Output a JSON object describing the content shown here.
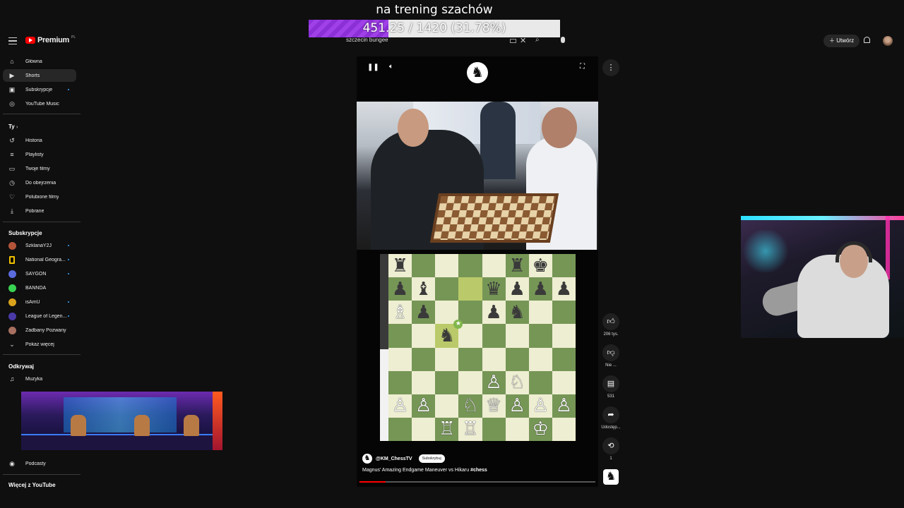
{
  "overlay": {
    "goal_title": "na trening szachów",
    "goal_text": "451.25 / 1420 (31.78%)",
    "goal_fraction": 0.3178,
    "bar_color": "#9a3ae0"
  },
  "topbar": {
    "brand": "Premium",
    "country": "PL",
    "search_value": "szczecin bungee",
    "create_label": "Utwórz"
  },
  "sidebar": {
    "main_items": [
      {
        "label": "Główna",
        "icon": "home-icon"
      },
      {
        "label": "Shorts",
        "icon": "shorts-icon",
        "active": true
      },
      {
        "label": "Subskrypcje",
        "icon": "subscriptions-icon"
      },
      {
        "label": "YouTube Music",
        "icon": "music-icon"
      }
    ],
    "you_heading": "Ty",
    "you_items": [
      {
        "label": "Historia",
        "icon": "history-icon"
      },
      {
        "label": "Playlisty",
        "icon": "playlist-icon"
      },
      {
        "label": "Twoje filmy",
        "icon": "your-videos-icon"
      },
      {
        "label": "Do obejrzenia",
        "icon": "watch-later-icon"
      },
      {
        "label": "Polubione filmy",
        "icon": "liked-icon"
      },
      {
        "label": "Pobrane",
        "icon": "download-icon"
      }
    ],
    "subs_heading": "Subskrypcje",
    "subs": [
      {
        "label": "SzklanaY2J",
        "color": "#b4553a"
      },
      {
        "label": "National Geogra...",
        "color": "#f2c200"
      },
      {
        "label": "SAYGON",
        "color": "#5a6bdc"
      },
      {
        "label": "BANNDA",
        "color": "#39d353"
      },
      {
        "label": "isAmU",
        "color": "#d9a21c"
      },
      {
        "label": "League of Legen...",
        "color": "#4a3aa8"
      },
      {
        "label": "Zadbany Pozwany",
        "color": "#a87060"
      }
    ],
    "show_more": "Pokaż więcej",
    "explore_heading": "Odkrywaj",
    "explore_items": [
      {
        "label": "Muzyka",
        "icon": "music-note-icon"
      },
      {
        "label": "Podcasty",
        "icon": "podcast-icon"
      }
    ],
    "more_heading": "Więcej z YouTube"
  },
  "player": {
    "channel_name": "@KM_ChessTV",
    "subscribe_label": "Subskrybuj",
    "title_text": "Magnus' Amazing Endgame Maneuver vs Hikaru ",
    "title_hashtag": "#chess",
    "progress_fraction": 0.11
  },
  "board": {
    "rows": [
      [
        "♜",
        "",
        "",
        "",
        "",
        "♜",
        "♚",
        ""
      ],
      [
        "♟",
        "♝",
        "",
        "",
        "♛",
        "♟",
        "♟",
        "♟"
      ],
      [
        "♗",
        "♟",
        "",
        "",
        "♟",
        "♞",
        "",
        ""
      ],
      [
        "",
        "",
        "♞",
        "",
        "",
        "",
        "",
        ""
      ],
      [
        "",
        "",
        "",
        "",
        "",
        "",
        "",
        ""
      ],
      [
        "",
        "",
        "",
        "",
        "♙",
        "♘",
        "",
        ""
      ],
      [
        "♙",
        "♙",
        "",
        "♘",
        "♕",
        "♙",
        "♙",
        "♙"
      ],
      [
        "",
        "",
        "♖",
        "♖",
        "",
        "",
        "♔",
        ""
      ]
    ],
    "white_pieces": [
      "♔",
      "♕",
      "♖",
      "♗",
      "♘",
      "♙"
    ],
    "highlight": [
      [
        1,
        3
      ],
      [
        3,
        2
      ]
    ],
    "star_square": [
      3,
      2
    ],
    "light_color": "#eeeed2",
    "dark_color": "#769656"
  },
  "actions": {
    "likes": "206 tys.",
    "dislike_label": "Nie ...",
    "comments": "531",
    "share_label": "Udostęp...",
    "remix_count": "1"
  }
}
